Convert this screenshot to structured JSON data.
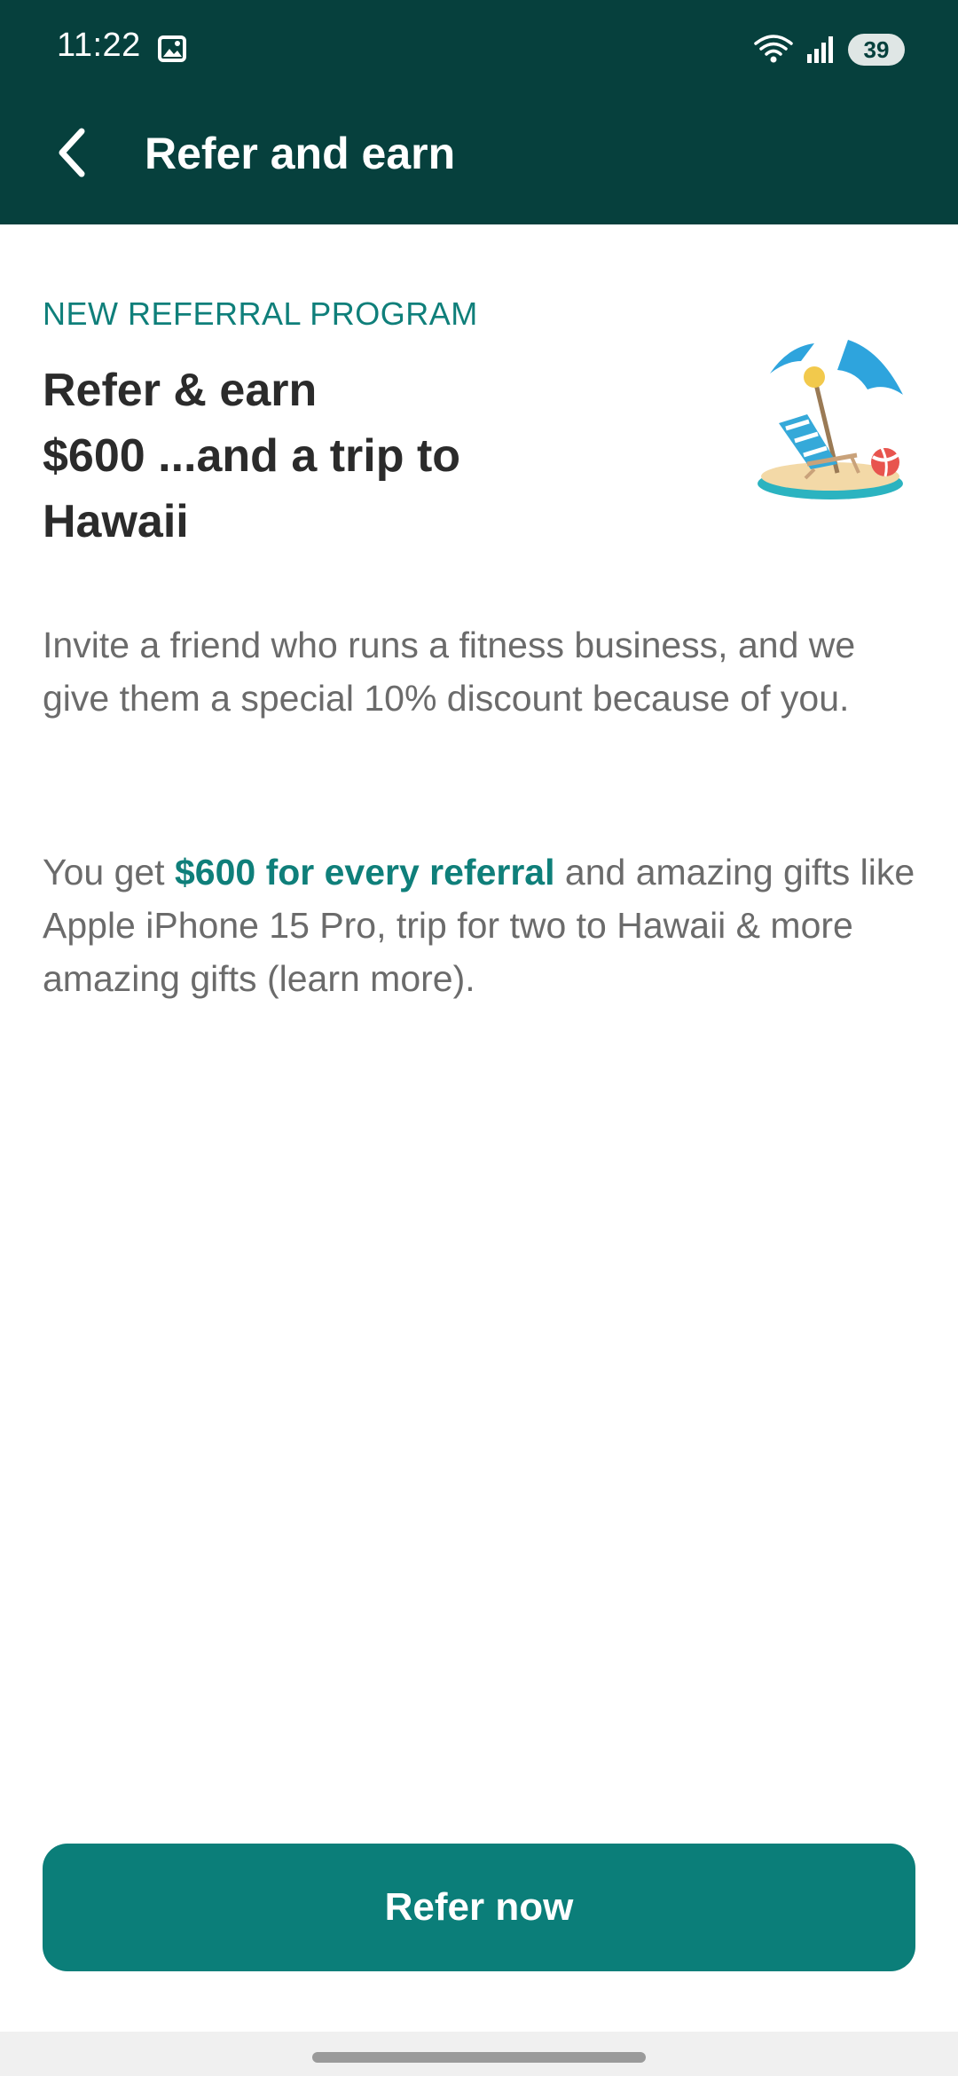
{
  "status_bar": {
    "time": "11:22",
    "battery": "39"
  },
  "appbar": {
    "title": "Refer and earn",
    "color": "#06403d"
  },
  "content": {
    "eyebrow": "NEW REFERRAL PROGRAM",
    "headline_lines": [
      "Refer & earn",
      "$600 ...and a trip to",
      "Hawaii"
    ],
    "paragraph1": "Invite a friend who runs a fitness business, and we give them a special 10% discount because of you.",
    "paragraph2": {
      "prefix": "You get ",
      "highlight": "$600 for every referral",
      "suffix": " and amazing gifts like Apple iPhone 15 Pro, trip for two to Hawaii & more amazing gifts (learn more)."
    },
    "accent_color": "#0f7f7a"
  },
  "cta": {
    "label": "Refer now",
    "color": "#0b7e79"
  },
  "icons": {
    "back": "back-arrow-icon",
    "gallery": "image-icon",
    "wifi": "wifi-icon",
    "signal": "signal-icon",
    "illustration": "beach-chair-umbrella-icon"
  }
}
